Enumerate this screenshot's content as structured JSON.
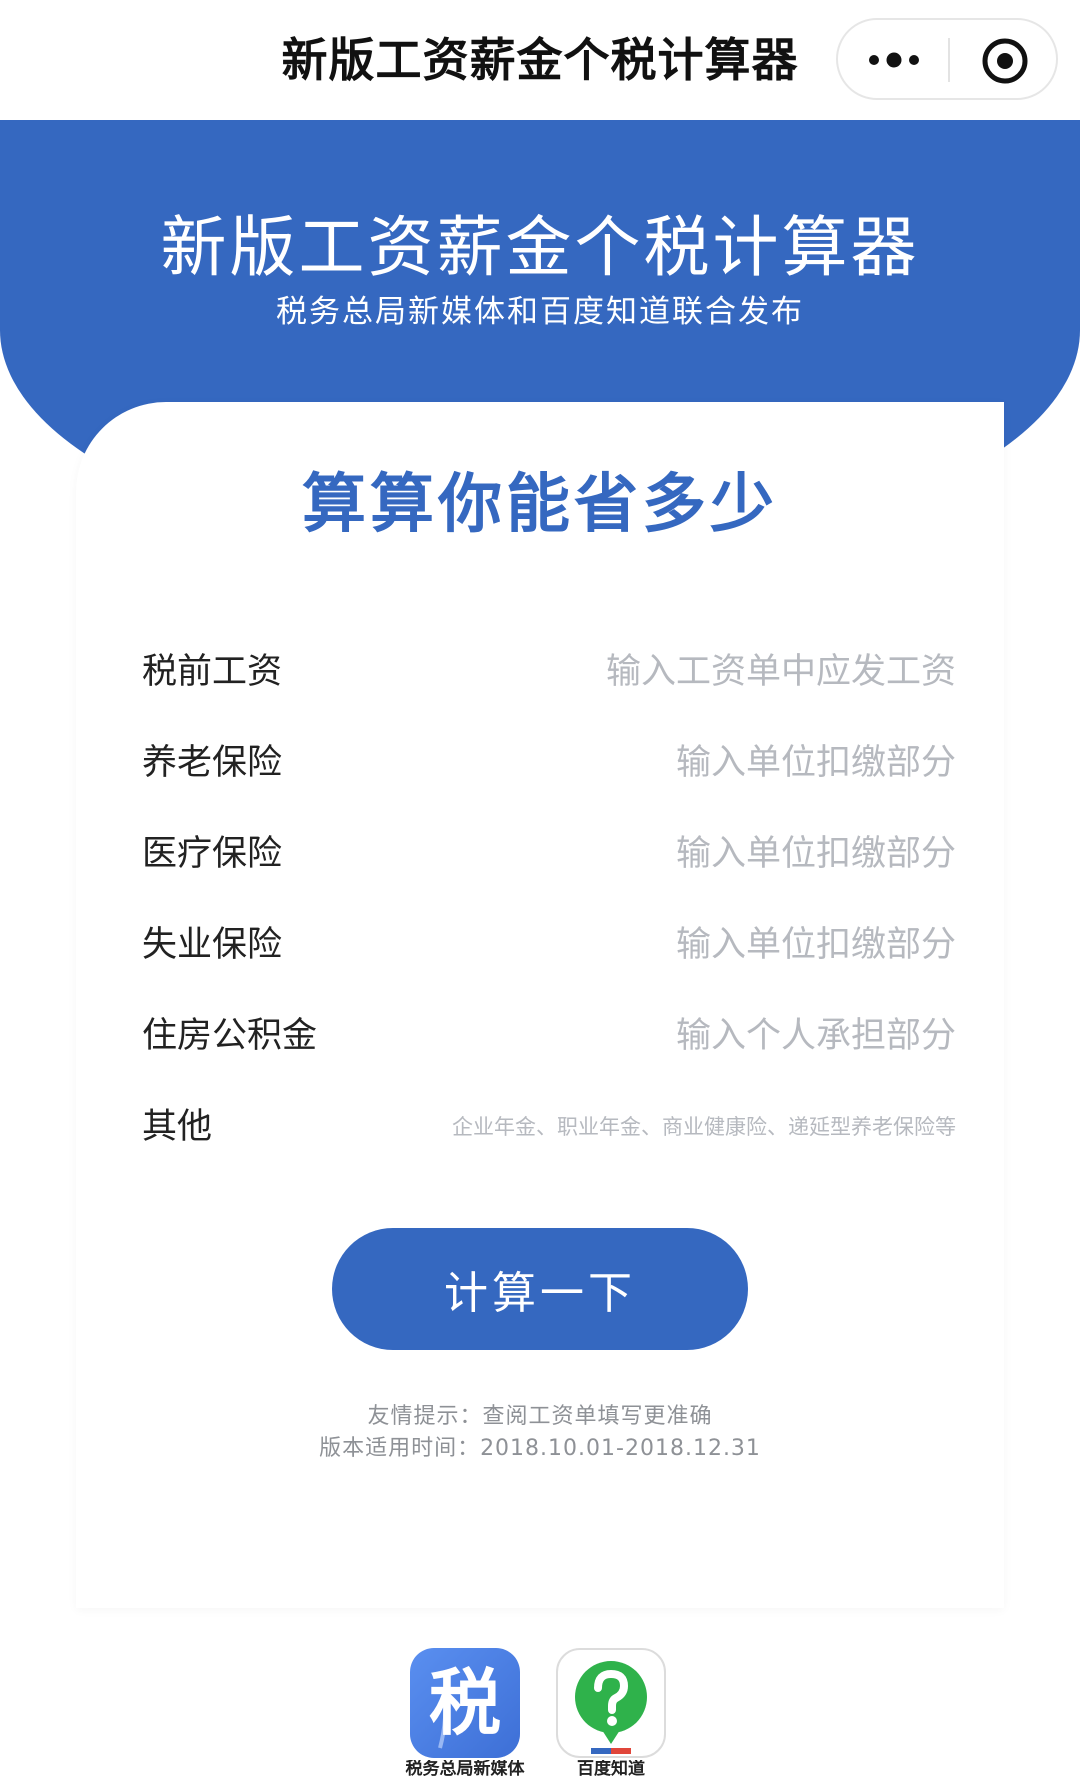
{
  "navbar": {
    "title": "新版工资薪金个税计算器",
    "more_icon": "more-dots-icon",
    "close_icon": "target-circle-icon"
  },
  "header": {
    "title": "新版工资薪金个税计算器",
    "subtitle": "税务总局新媒体和百度知道联合发布"
  },
  "card": {
    "heading": "算算你能省多少",
    "fields": [
      {
        "label": "税前工资",
        "placeholder": "输入工资单中应发工资"
      },
      {
        "label": "养老保险",
        "placeholder": "输入单位扣缴部分"
      },
      {
        "label": "医疗保险",
        "placeholder": "输入单位扣缴部分"
      },
      {
        "label": "失业保险",
        "placeholder": "输入单位扣缴部分"
      },
      {
        "label": "住房公积金",
        "placeholder": "输入个人承担部分"
      },
      {
        "label": "其他",
        "placeholder": "企业年金、职业年金、商业健康险、递延型养老保险等"
      }
    ],
    "button_label": "计算一下",
    "tip": "友情提示：查阅工资单填写更准确",
    "version": "版本适用时间：2018.10.01-2018.12.31"
  },
  "footer": {
    "tax_logo_char": "税",
    "tax_caption": "税务总局新媒体",
    "baidu_caption": "百度知道"
  },
  "colors": {
    "brand_blue": "#3568c0",
    "placeholder_gray": "#b6b9bf",
    "baidu_green": "#2fb24b"
  }
}
